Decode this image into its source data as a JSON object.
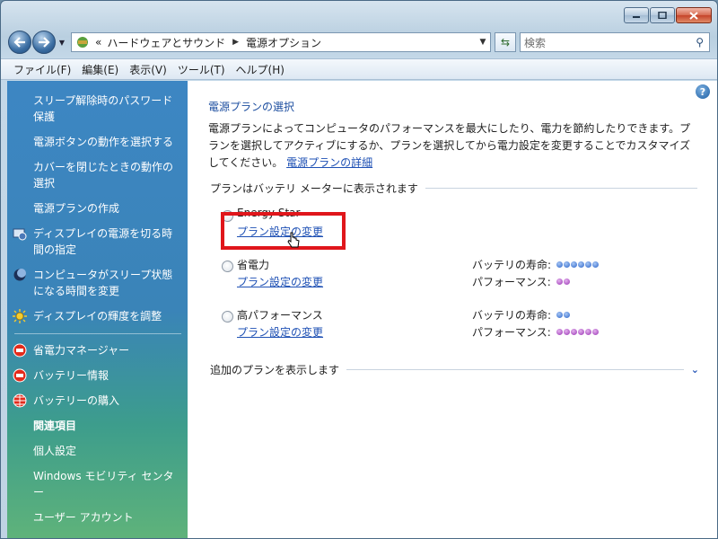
{
  "nav": {
    "back_icon": "back-arrow-icon",
    "forward_icon": "forward-arrow-icon",
    "address_prefix": "«",
    "breadcrumb_1": "ハードウェアとサウンド",
    "breadcrumb_2": "電源オプション",
    "search_placeholder": "検索"
  },
  "menubar": {
    "file": "ファイル(F)",
    "edit": "編集(E)",
    "view": "表示(V)",
    "tools": "ツール(T)",
    "help": "ヘルプ(H)"
  },
  "sidebar": {
    "items": [
      {
        "label": "スリープ解除時のパスワード保護"
      },
      {
        "label": "電源ボタンの動作を選択する"
      },
      {
        "label": "カバーを閉じたときの動作の選択"
      },
      {
        "label": "電源プランの作成"
      },
      {
        "label": "ディスプレイの電源を切る時間の指定",
        "icon": "display-clock-icon"
      },
      {
        "label": "コンピュータがスリープ状態になる時間を変更",
        "icon": "moon-icon"
      },
      {
        "label": "ディスプレイの輝度を調整",
        "icon": "sun-icon"
      }
    ],
    "extra": [
      {
        "label": "省電力マネージャー",
        "icon": "power-manager-icon"
      },
      {
        "label": "バッテリー情報",
        "icon": "battery-info-icon"
      },
      {
        "label": "バッテリーの購入",
        "icon": "globe-icon"
      }
    ],
    "related_heading": "関連項目",
    "related": [
      {
        "label": "個人設定"
      },
      {
        "label": "Windows モビリティ センター"
      },
      {
        "label": "ユーザー アカウント"
      }
    ]
  },
  "main": {
    "title": "電源プランの選択",
    "intro_text": "電源プランによってコンピュータのパフォーマンスを最大にしたり、電力を節約したりできます。プランを選択してアクティブにするか、プランを選択してから電力設定を変更することでカスタマイズしてください。",
    "intro_link": "電源プランの詳細",
    "group_heading": "プランはバッテリ メーターに表示されます",
    "plans": [
      {
        "name": "Energy Star",
        "link": "プラン設定の変更"
      },
      {
        "name": "省電力",
        "link": "プラン設定の変更",
        "battery_label": "バッテリの寿命:",
        "battery_dots": 6,
        "perf_label": "パフォーマンス:",
        "perf_dots": 2
      },
      {
        "name": "高パフォーマンス",
        "link": "プラン設定の変更",
        "battery_label": "バッテリの寿命:",
        "battery_dots": 2,
        "perf_label": "パフォーマンス:",
        "perf_dots": 6
      }
    ],
    "more_plans": "追加のプランを表示します"
  },
  "colors": {
    "link": "#1e50b4",
    "highlight": "#e0161b",
    "battery_dot": "#2a63c9",
    "perf_dot": "#9a33b4"
  }
}
